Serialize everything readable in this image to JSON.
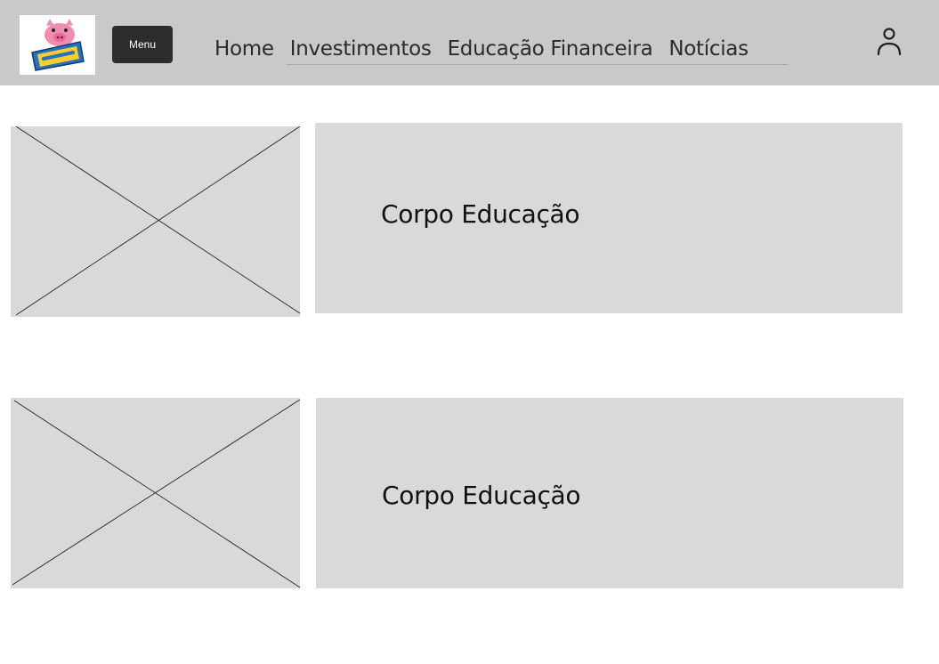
{
  "header": {
    "logo_icon": "piggy-bank-logo-icon",
    "menu_label": "Menu",
    "nav": [
      {
        "label": "Home"
      },
      {
        "label": "Investimentos"
      },
      {
        "label": "Educação Financeira"
      },
      {
        "label": "Notícias"
      }
    ],
    "user_icon": "user-profile-icon"
  },
  "content": {
    "items": [
      {
        "image_icon": "image-placeholder-icon",
        "body": "Corpo Educação"
      },
      {
        "image_icon": "image-placeholder-icon",
        "body": "Corpo Educação"
      }
    ]
  },
  "colors": {
    "header_bg": "#c9c9c9",
    "menu_button_bg": "#2c2c2c",
    "card_bg": "#d9d9d9"
  }
}
